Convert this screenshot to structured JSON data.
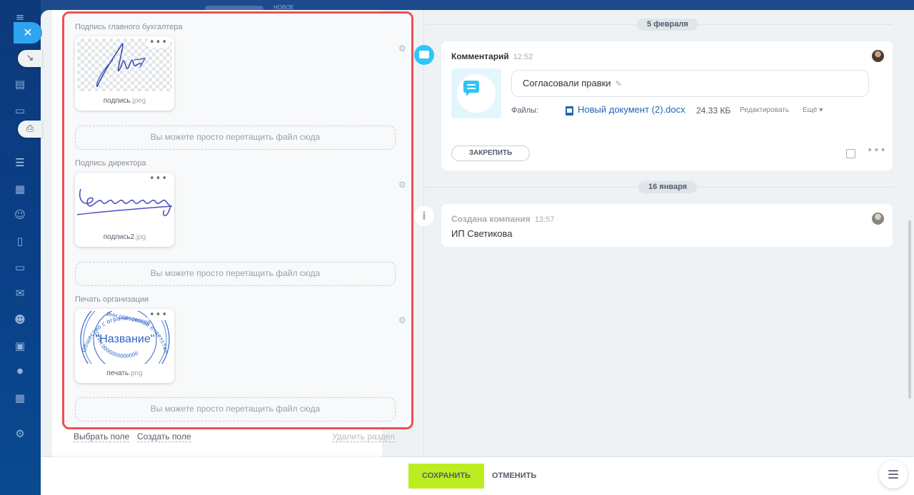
{
  "sidebar": {
    "icons": [
      "menu-icon",
      "close-icon",
      "collapse-icon",
      "tasks-icon",
      "chat-icon",
      "shield-icon",
      "filter-icon",
      "calendar-icon",
      "robot-icon",
      "document-icon",
      "card-icon",
      "mail-icon",
      "contacts-icon",
      "display-icon",
      "circle-icon",
      "table-icon",
      "settings-icon"
    ],
    "close_glyph": "✕",
    "print_glyph": "⎙",
    "collapse_glyph": "↘"
  },
  "topbar": {
    "new_label": "НОВОЕ"
  },
  "left": {
    "fields": [
      {
        "label": "Подпись главного бухгалтера",
        "file_base": "подпись",
        "file_ext": ".jpeg",
        "dropzone": "Вы можете просто перетащить файл сюда"
      },
      {
        "label": "Подпись директора",
        "file_base": "подпись2",
        "file_ext": ".jpg",
        "dropzone": "Вы можете просто перетащить файл сюда"
      },
      {
        "label": "Печать организации",
        "file_base": "печать",
        "file_ext": ".png",
        "dropzone": "Вы можете просто перетащить файл сюда"
      }
    ],
    "stamp": {
      "name": "\"Название\"",
      "top_text": "Общество с ограниченной ответственностью",
      "inn_text": "ИНН 0000000000",
      "ogrn_text": "ОГРН 0000000000000"
    },
    "dots": "•••",
    "footer": {
      "select_field": "Выбрать поле",
      "create_field": "Создать поле",
      "delete_section": "Удалить раздел"
    }
  },
  "timeline": {
    "date1": "5 февраля",
    "date2": "16 января",
    "comment": {
      "title": "Комментарий",
      "time": "12:52",
      "text": "Согласовали правки",
      "files_label": "Файлы:",
      "file_name": "Новый документ (2).docx",
      "file_size": "24.33 КБ",
      "edit_label": "Редактировать",
      "more_label": "Ещё ▾",
      "pin_label": "ЗАКРЕПИТЬ",
      "dots": "•••"
    },
    "company": {
      "title": "Создана компания",
      "time": "13:57",
      "name": "ИП Светикова",
      "info_glyph": "i"
    }
  },
  "bottom": {
    "save_label": "СОХРАНИТЬ",
    "cancel_label": "ОТМЕНИТЬ"
  },
  "colors": {
    "accent_blue": "#2fc6f6",
    "save_green": "#bbed21",
    "highlight_red": "#ef4f55",
    "link_blue": "#2067b0"
  }
}
